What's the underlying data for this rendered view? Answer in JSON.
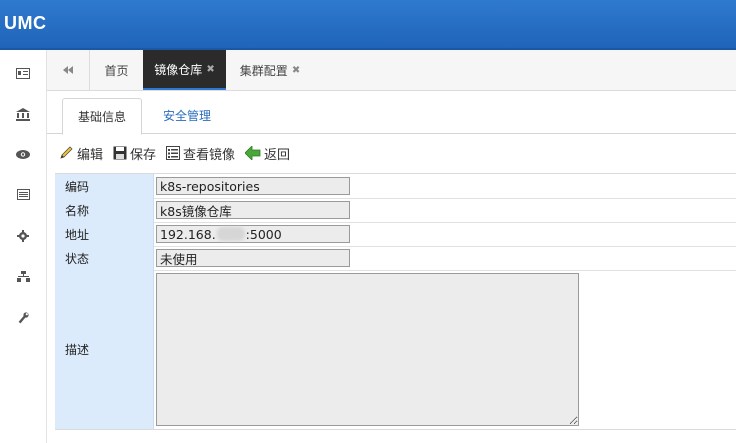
{
  "app": {
    "logo": "UMC"
  },
  "sidebar": {
    "icons": [
      "id-card-icon",
      "bank-icon",
      "eye-icon",
      "list-icon",
      "gear-icon",
      "sitemap-icon",
      "wrench-icon"
    ]
  },
  "tabs": {
    "items": [
      {
        "label": "首页",
        "closable": false,
        "active": false
      },
      {
        "label": "镜像仓库",
        "closable": true,
        "active": true
      },
      {
        "label": "集群配置",
        "closable": true,
        "active": false
      }
    ],
    "close_glyph": "✖"
  },
  "subtabs": {
    "basic": "基础信息",
    "security": "安全管理"
  },
  "toolbar": {
    "edit": "编辑",
    "save": "保存",
    "view_images": "查看镜像",
    "back": "返回"
  },
  "form": {
    "code_label": "编码",
    "code_value": "k8s-repositories",
    "name_label": "名称",
    "name_value": "k8s镜像仓库",
    "address_label": "地址",
    "address_prefix": "192.168.",
    "address_suffix": ":5000",
    "status_label": "状态",
    "status_value": "未使用",
    "desc_label": "描述",
    "desc_value": ""
  },
  "colors": {
    "header": "#2270c4",
    "label_bg": "#dcebfb",
    "active_tab": "#2b2b2b",
    "link": "#2a6ebb"
  }
}
